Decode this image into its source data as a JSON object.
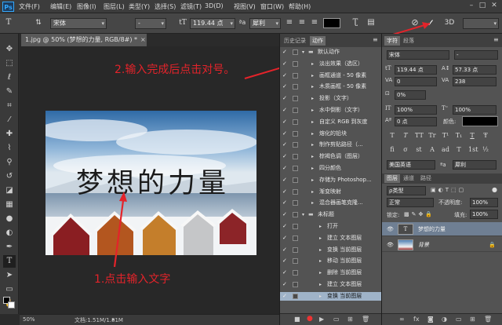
{
  "menubar": {
    "logo": "Ps",
    "items": [
      "文件(F)",
      "编辑(E)",
      "图像(I)",
      "图层(L)",
      "类型(Y)",
      "选择(S)",
      "滤镜(T)",
      "3D(D)",
      "视图(V)",
      "窗口(W)",
      "帮助(H)"
    ]
  },
  "options": {
    "font_family": "宋体",
    "font_style": "-",
    "font_size": "119.44 点",
    "aa_label": "ªa",
    "aa_mode": "犀利",
    "color": "#000000"
  },
  "document": {
    "tab_title": "1.jpg @ 50% (梦想的力量, RGB/8#) *",
    "canvas_text": "梦想的力量",
    "zoom": "50%",
    "doc_info": "文档:1.51M/1.81M"
  },
  "annotations": {
    "step1": "1.点击输入文字",
    "step2": "2.输入完成后点击对号。"
  },
  "actions_panel": {
    "tabs": [
      "历史记录",
      "动作"
    ],
    "rows": [
      {
        "label": "默认动作",
        "indent": 0,
        "check": true,
        "folder": true
      },
      {
        "label": "淡出效果（选区）",
        "indent": 1,
        "check": true
      },
      {
        "label": "画框通道 - 50 像素",
        "indent": 1,
        "check": true
      },
      {
        "label": "木质画框 - 50 像素",
        "indent": 1,
        "check": true
      },
      {
        "label": "投影（文字）",
        "indent": 1,
        "check": true
      },
      {
        "label": "水中倒影（文字）",
        "indent": 1,
        "check": true
      },
      {
        "label": "自定义 RGB 到灰度",
        "indent": 1,
        "check": true
      },
      {
        "label": "熔化的铅块",
        "indent": 1,
        "check": true
      },
      {
        "label": "制作剪贴路径（...",
        "indent": 1,
        "check": true
      },
      {
        "label": "棕褐色调（图层）",
        "indent": 1,
        "check": true
      },
      {
        "label": "四分颜色",
        "indent": 1,
        "check": true
      },
      {
        "label": "存储为 Photoshop...",
        "indent": 1,
        "check": true
      },
      {
        "label": "渐变映射",
        "indent": 1,
        "check": true
      },
      {
        "label": "混合器画笔克隆...",
        "indent": 1,
        "check": true
      },
      {
        "label": "未标题",
        "indent": 0,
        "check": true,
        "folder": true
      },
      {
        "label": "打开",
        "indent": 2,
        "check": true
      },
      {
        "label": "建立 文本图层",
        "indent": 2,
        "check": true
      },
      {
        "label": "变换 当前图层",
        "indent": 2,
        "check": true
      },
      {
        "label": "移动 当前图层",
        "indent": 2,
        "check": true
      },
      {
        "label": "删除 当前图层",
        "indent": 2,
        "check": true
      },
      {
        "label": "建立 文本图层",
        "indent": 2,
        "check": true
      },
      {
        "label": "变换 当前图层",
        "indent": 2,
        "check": true,
        "selected": true
      }
    ]
  },
  "char_panel": {
    "tabs": [
      "字符",
      "段落"
    ],
    "font_family": "宋体",
    "font_style": "-",
    "font_size": "119.44 点",
    "leading": "57.33 点",
    "kerning": "0",
    "tracking": "238",
    "tsume": "0%",
    "vscale": "100%",
    "hscale": "100%",
    "baseline": "0 点",
    "color_label": "颜色:",
    "glyphs": [
      "T",
      "T",
      "TT",
      "Tr",
      "T¹",
      "T₁",
      "T",
      "Ŧ"
    ],
    "glyphs2": [
      "fi",
      "σ",
      "st",
      "A",
      "ad",
      "T",
      "1st",
      "½"
    ],
    "language": "美国英语",
    "aa_label": "ªa",
    "aa_mode": "犀利"
  },
  "layers_panel": {
    "tabs": [
      "图层",
      "通道",
      "路径"
    ],
    "kind_label": "ρ类型",
    "blend_mode": "正常",
    "opacity_label": "不透明度:",
    "opacity": "100%",
    "lock_label": "锁定:",
    "fill_label": "填充:",
    "fill": "100%",
    "layers": [
      {
        "name": "梦想的力量",
        "thumb": "T",
        "selected": true
      },
      {
        "name": "背景",
        "thumb": "img",
        "italic": true,
        "locked": true
      }
    ]
  }
}
